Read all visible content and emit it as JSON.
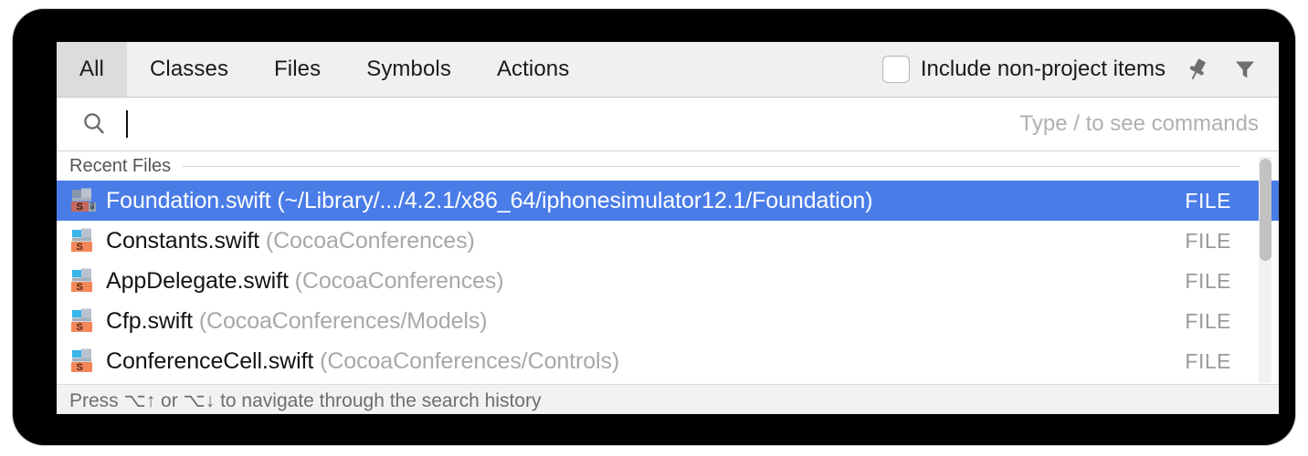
{
  "tabs": [
    {
      "label": "All",
      "selected": true
    },
    {
      "label": "Classes",
      "selected": false
    },
    {
      "label": "Files",
      "selected": false
    },
    {
      "label": "Symbols",
      "selected": false
    },
    {
      "label": "Actions",
      "selected": false
    }
  ],
  "header": {
    "include_non_project_label": "Include non-project items",
    "include_non_project_checked": false,
    "pin_icon": "pin-icon",
    "filter_icon": "filter-icon"
  },
  "search": {
    "icon": "search-icon",
    "value": "",
    "placeholder": "",
    "hint": "Type / to see commands"
  },
  "results": {
    "group_label": "Recent Files",
    "rows": [
      {
        "name": "Foundation.swift",
        "location": "(~/Library/.../4.2.1/x86_64/iphonesimulator12.1/Foundation)",
        "kind": "FILE",
        "selected": true,
        "icon": "swift-file-locked-icon"
      },
      {
        "name": "Constants.swift",
        "location": "(CocoaConferences)",
        "kind": "FILE",
        "selected": false,
        "icon": "swift-file-icon"
      },
      {
        "name": "AppDelegate.swift",
        "location": "(CocoaConferences)",
        "kind": "FILE",
        "selected": false,
        "icon": "swift-file-icon"
      },
      {
        "name": "Cfp.swift",
        "location": "(CocoaConferences/Models)",
        "kind": "FILE",
        "selected": false,
        "icon": "swift-file-icon"
      },
      {
        "name": "ConferenceCell.swift",
        "location": "(CocoaConferences/Controls)",
        "kind": "FILE",
        "selected": false,
        "icon": "swift-file-icon"
      }
    ]
  },
  "footer": {
    "hint": "Press ⌥↑ or ⌥↓ to navigate through the search history"
  },
  "colors": {
    "selection_blue": "#4a7ce8",
    "tabbar_bg": "#f0f0f0",
    "selected_tab_bg": "#dcdcdc",
    "muted_text": "#a8a8a8",
    "swift_badge_orange": "#f2875a",
    "swift_badge_locked": "#c4695c"
  }
}
